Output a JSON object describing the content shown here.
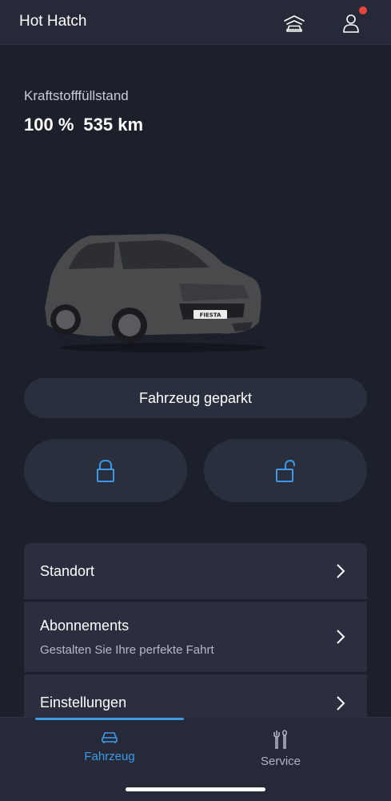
{
  "header": {
    "title": "Hot Hatch",
    "garage_icon": "garage-icon",
    "account_icon": "account-icon",
    "notification_color": "#e8453c"
  },
  "fuel": {
    "label": "Kraftstofffüllstand",
    "level": "100 %",
    "range": "535 km"
  },
  "vehicle": {
    "plate": "FIESTA",
    "color": "#4a4a4c"
  },
  "status": {
    "label": "Fahrzeug geparkt"
  },
  "controls": {
    "lock_icon": "lock-icon",
    "unlock_icon": "unlock-icon",
    "accent": "#3d9ae8"
  },
  "menu": {
    "standort": {
      "title": "Standort"
    },
    "abonnements": {
      "title": "Abonnements",
      "subtitle": "Gestalten Sie Ihre perfekte Fahrt"
    },
    "einstellungen": {
      "title": "Einstellungen"
    }
  },
  "nav": {
    "tabs": [
      {
        "label": "Fahrzeug",
        "icon": "car-icon",
        "active": true
      },
      {
        "label": "Service",
        "icon": "tools-icon",
        "active": false
      }
    ]
  }
}
